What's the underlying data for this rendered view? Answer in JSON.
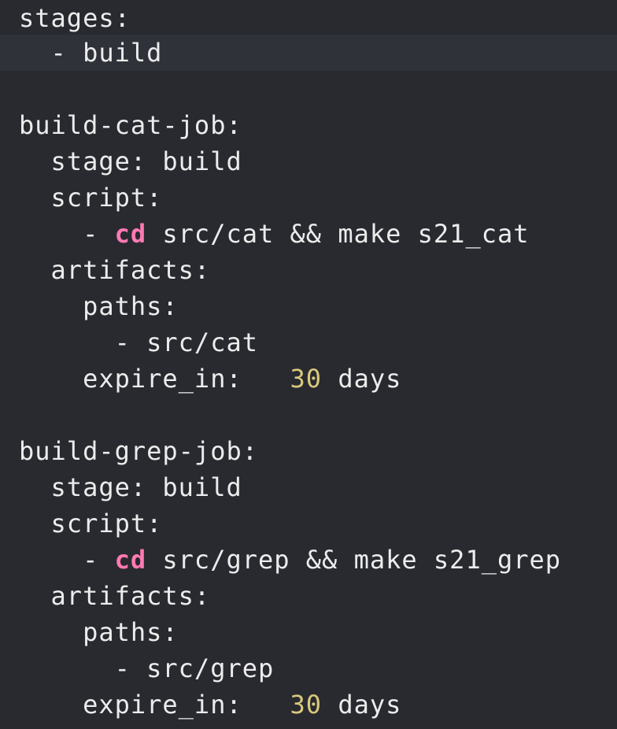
{
  "editor": {
    "language": "yaml",
    "theme_colors": {
      "background": "#292a30",
      "current_line": "#2f3239",
      "text": "#ececec",
      "keyword": "#ff7ab2",
      "number": "#d9c97c"
    },
    "lines": [
      {
        "text": "stages:"
      },
      {
        "text": "  - build",
        "current": true
      },
      {
        "text": ""
      },
      {
        "text": "build-cat-job:"
      },
      {
        "text": "  stage: build"
      },
      {
        "text": "  script:"
      },
      {
        "indent": "    - ",
        "keyword": "cd",
        "rest": " src/cat && make s21_cat"
      },
      {
        "text": "  artifacts:"
      },
      {
        "text": "    paths:"
      },
      {
        "text": "      - src/cat"
      },
      {
        "prefix": "    expire_in:   ",
        "number": "30",
        "rest": " days"
      },
      {
        "text": ""
      },
      {
        "text": "build-grep-job:"
      },
      {
        "text": "  stage: build"
      },
      {
        "text": "  script:"
      },
      {
        "indent": "    - ",
        "keyword": "cd",
        "rest": " src/grep && make s21_grep"
      },
      {
        "text": "  artifacts:"
      },
      {
        "text": "    paths:"
      },
      {
        "text": "      - src/grep"
      },
      {
        "prefix": "    expire_in:   ",
        "number": "30",
        "rest": " days"
      }
    ]
  }
}
